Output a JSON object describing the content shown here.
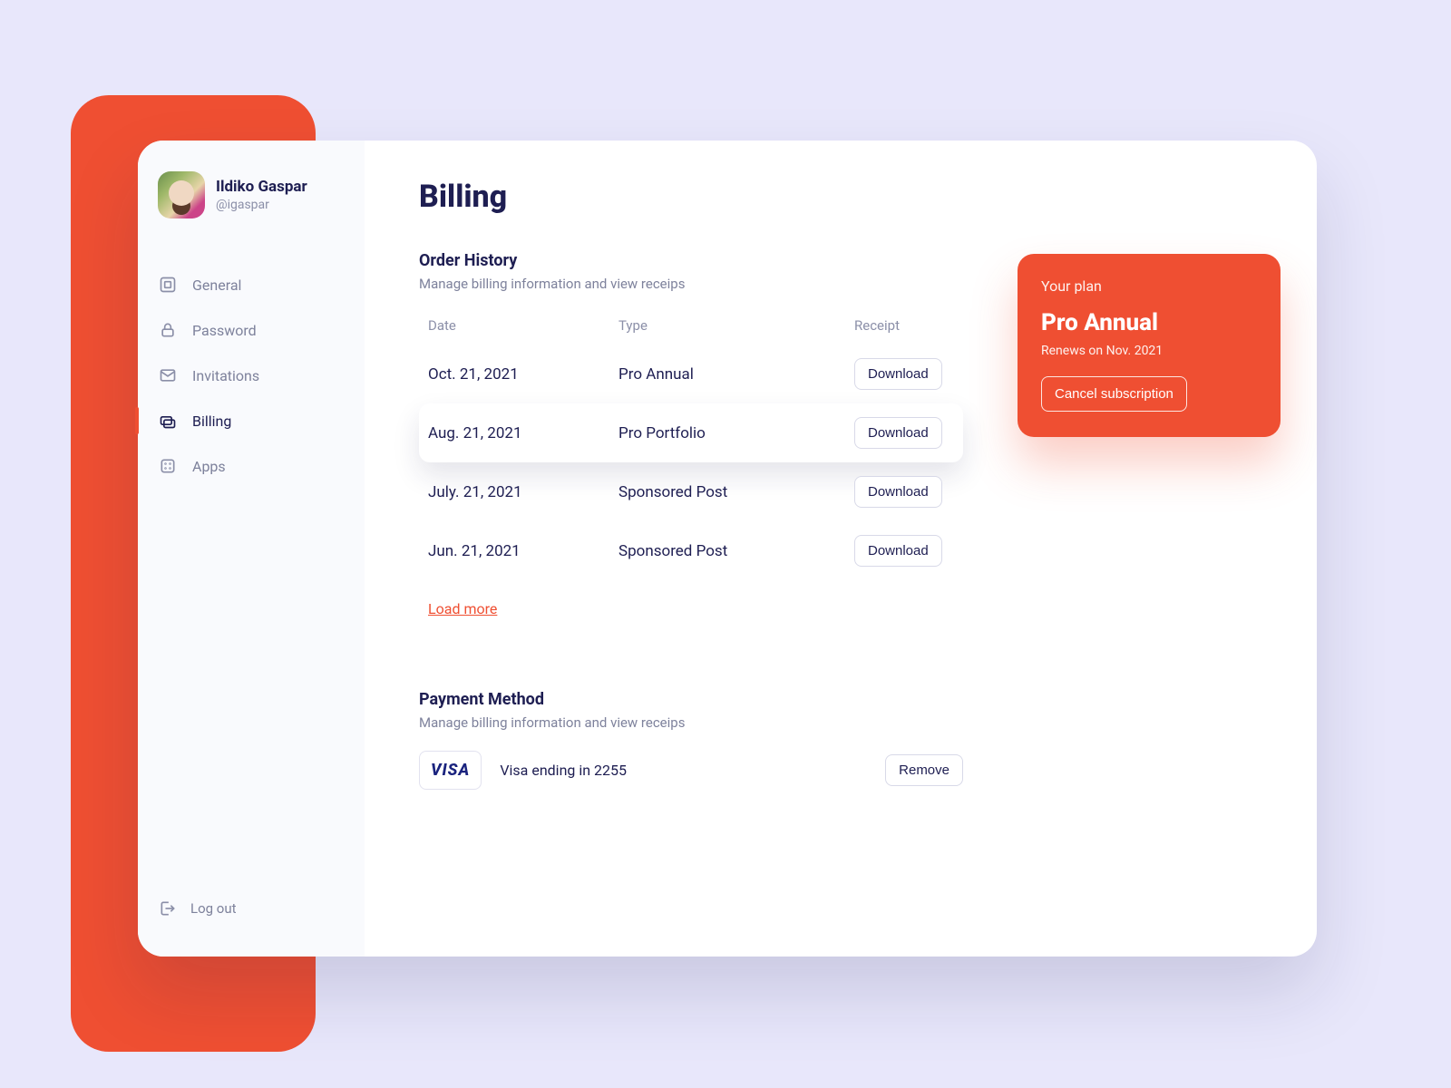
{
  "profile": {
    "name": "Ildiko Gaspar",
    "handle": "@igaspar"
  },
  "sidebar": {
    "items": [
      {
        "label": "General"
      },
      {
        "label": "Password"
      },
      {
        "label": "Invitations"
      },
      {
        "label": "Billing"
      },
      {
        "label": "Apps"
      }
    ],
    "logout": "Log out"
  },
  "page": {
    "title": "Billing"
  },
  "order_history": {
    "title": "Order History",
    "subtitle": "Manage billing information and view receips",
    "columns": {
      "date": "Date",
      "type": "Type",
      "receipt": "Receipt"
    },
    "rows": [
      {
        "date": "Oct. 21, 2021",
        "type": "Pro Annual",
        "action": "Download"
      },
      {
        "date": "Aug. 21, 2021",
        "type": "Pro Portfolio",
        "action": "Download"
      },
      {
        "date": "July. 21, 2021",
        "type": "Sponsored Post",
        "action": "Download"
      },
      {
        "date": "Jun. 21, 2021",
        "type": "Sponsored Post",
        "action": "Download"
      }
    ],
    "load_more": "Load more"
  },
  "payment": {
    "title": "Payment Method",
    "subtitle": "Manage billing information and view receips",
    "brand": "VISA",
    "description": "Visa ending in 2255",
    "remove": "Remove"
  },
  "plan": {
    "label": "Your plan",
    "name": "Pro Annual",
    "renews": "Renews on  Nov. 2021",
    "cancel": "Cancel subscription"
  }
}
